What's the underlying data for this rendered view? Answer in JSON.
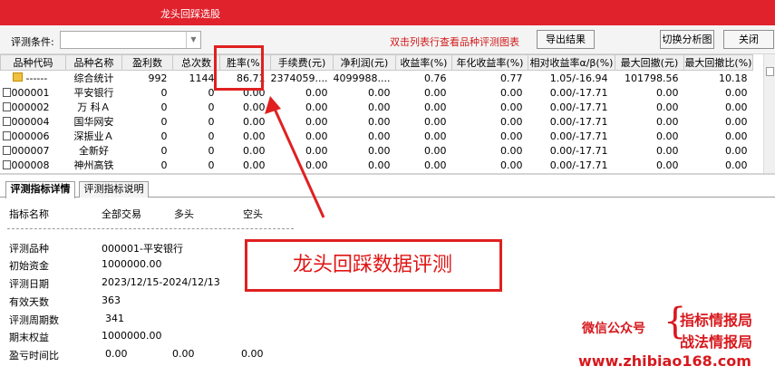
{
  "window": {
    "title": "龙头回踩选股"
  },
  "toolbar": {
    "condition_label": "评测条件:",
    "condition_value": "",
    "hint": "双击列表行查看品种评测图表",
    "export_label": "导出结果",
    "switch_label": "切换分析图",
    "close_label": "关闭"
  },
  "table": {
    "columns": [
      "品种代码",
      "品种名称",
      "盈利数",
      "总次数",
      "胜率(%)",
      "手续费(元)",
      "净利润(元)",
      "收益率(%)",
      "年化收益率(%)",
      "相对收益率α/β(%)",
      "最大回撤(元)",
      "最大回撤比(%)"
    ],
    "total": {
      "code": "------",
      "name": "综合统计",
      "wins": "992",
      "total": "1144",
      "winrate": "86.71",
      "fee": "2374059....",
      "profit": "4099988....",
      "ret": "0.76",
      "annual": "0.77",
      "relative": "1.05/-16.94",
      "maxdd": "101798.56",
      "maxdd_ratio": "10.18"
    },
    "rows": [
      {
        "code": "000001",
        "name": "平安银行",
        "wins": "0",
        "total": "0",
        "winrate": "0.00",
        "fee": "0.00",
        "profit": "0.00",
        "ret": "0.00",
        "annual": "0.00",
        "relative": "0.00/-17.71",
        "maxdd": "0.00",
        "maxdd_ratio": "0.00"
      },
      {
        "code": "000002",
        "name": "万 科Ａ",
        "wins": "0",
        "total": "0",
        "winrate": "0.00",
        "fee": "0.00",
        "profit": "0.00",
        "ret": "0.00",
        "annual": "0.00",
        "relative": "0.00/-17.71",
        "maxdd": "0.00",
        "maxdd_ratio": "0.00"
      },
      {
        "code": "000004",
        "name": "国华网安",
        "wins": "0",
        "total": "0",
        "winrate": "0.00",
        "fee": "0.00",
        "profit": "0.00",
        "ret": "0.00",
        "annual": "0.00",
        "relative": "0.00/-17.71",
        "maxdd": "0.00",
        "maxdd_ratio": "0.00"
      },
      {
        "code": "000006",
        "name": "深振业Ａ",
        "wins": "0",
        "total": "0",
        "winrate": "0.00",
        "fee": "0.00",
        "profit": "0.00",
        "ret": "0.00",
        "annual": "0.00",
        "relative": "0.00/-17.71",
        "maxdd": "0.00",
        "maxdd_ratio": "0.00"
      },
      {
        "code": "000007",
        "name": "全新好",
        "wins": "0",
        "total": "0",
        "winrate": "0.00",
        "fee": "0.00",
        "profit": "0.00",
        "ret": "0.00",
        "annual": "0.00",
        "relative": "0.00/-17.71",
        "maxdd": "0.00",
        "maxdd_ratio": "0.00"
      },
      {
        "code": "000008",
        "name": "神州高铁",
        "wins": "0",
        "total": "0",
        "winrate": "0.00",
        "fee": "0.00",
        "profit": "0.00",
        "ret": "0.00",
        "annual": "0.00",
        "relative": "0.00/-17.71",
        "maxdd": "0.00",
        "maxdd_ratio": "0.00"
      }
    ]
  },
  "tabs": {
    "detail": "评测指标详情",
    "explain": "评测指标说明"
  },
  "detail": {
    "headers": {
      "name": "指标名称",
      "all": "全部交易",
      "long": "多头",
      "short": "空头"
    },
    "rows": [
      {
        "label": "评测品种",
        "value": "000001-平安银行"
      },
      {
        "label": "初始资金",
        "value": "1000000.00"
      },
      {
        "label": "评测日期",
        "value": "2023/12/15-2024/12/13"
      },
      {
        "label": "有效天数",
        "value": "363"
      },
      {
        "label": "评测周期数",
        "value": "341"
      },
      {
        "label": "期末权益",
        "value": "1000000.00"
      }
    ],
    "pnl_ratio": {
      "label": "盈亏时间比",
      "all": "0.00",
      "long": "0.00",
      "short": "0.00"
    }
  },
  "annotation": {
    "text": "龙头回踩数据评测"
  },
  "watermark": {
    "wechat": "微信公众号",
    "line1": "指标情报局",
    "line2": "战法情报局",
    "site": "www.zhibiao168.com"
  },
  "colors": {
    "titlebar": "#e0222c",
    "accent_red": "#e02020"
  }
}
